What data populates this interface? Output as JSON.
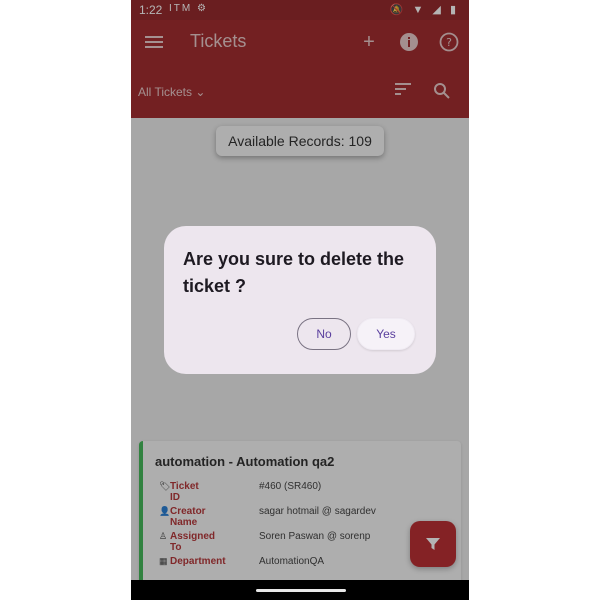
{
  "status_bar": {
    "time": "1:22",
    "left_icons": [
      "itm-badge-icon",
      "settings-icon"
    ],
    "right_icons": [
      "do-not-disturb-icon",
      "wifi-icon",
      "signal-icon",
      "battery-icon"
    ]
  },
  "app_bar": {
    "title": "Tickets",
    "icons": [
      "menu-icon",
      "add-icon",
      "info-icon",
      "help-icon"
    ]
  },
  "filter_bar": {
    "selected_filter": "All Tickets",
    "icons": [
      "sort-icon",
      "search-icon"
    ]
  },
  "records": {
    "label": "Available Records: 109"
  },
  "ticket": {
    "title": "automation - Automation qa2",
    "rows": [
      {
        "label": "Ticket ID",
        "value": "#460  (SR460)"
      },
      {
        "label": "Creator Name",
        "value": "sagar hotmail @ sagardev"
      },
      {
        "label": "Assigned To",
        "value": "Soren Paswan @ sorenp"
      },
      {
        "label": "Department",
        "value": "AutomationQA"
      }
    ]
  },
  "dialog": {
    "message": "Are you sure to delete the ticket ?",
    "no_label": "No",
    "yes_label": "Yes"
  },
  "colors": {
    "app_bar": "#9b1c1f",
    "accent_label": "#b0282b",
    "card_border": "#37b24d",
    "dialog_bg": "#ede6ee",
    "button_text": "#5a3f9e"
  }
}
